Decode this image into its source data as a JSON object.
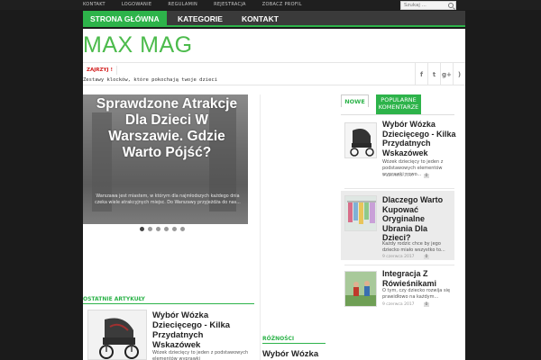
{
  "topbar": {
    "links": [
      "KONTAKT",
      "LOGOWANIE",
      "REGULAMIN",
      "REJESTRACJA",
      "ZOBACZ PROFIL"
    ],
    "search_placeholder": "Szukaj ..."
  },
  "nav": {
    "items": [
      "STRONA GŁÓWNA",
      "KATEGORIE",
      "KONTAKT"
    ],
    "active_index": 0,
    "accent_color": "#2db34a"
  },
  "logo": {
    "text": "MAX MAG"
  },
  "ticker": {
    "label": "ZAJRZYJ !",
    "text": "Zestawy klocków, które pokochają twoje dzieci"
  },
  "social_icons": [
    "facebook-icon",
    "twitter-icon",
    "googleplus-icon",
    "rss-icon"
  ],
  "slider": {
    "title": "Sprawdzone Atrakcje Dla Dzieci W Warszawie. Gdzie Warto Pójść?",
    "excerpt": "Warszawa jest miastem, w którym dla najmłodszych każdego dnia czeka wiele atrakcyjnych miejsc. Do Warszawy przyjeżdża do nas...",
    "dot_count": 6,
    "active_dot": 0
  },
  "recent": {
    "label": "OSTATNIE ARTYKUŁY",
    "title": "Wybór Wózka Dziecięcego - Kilka Przydatnych Wskazówek",
    "excerpt": "Wózek dziecięcy to jeden z podstawowych elementów wyprawki"
  },
  "misc": {
    "label": "RÓŻNOŚCI",
    "title": "Wybór Wózka Dziecięcego"
  },
  "sidebar": {
    "tab_new": "NOWE",
    "tab_popular": "POPULARNE",
    "tab_comments": "KOMENTARZE",
    "items": [
      {
        "title": "Wybór Wózka Dziecięcego - Kilka Przydatnych Wskazówek",
        "excerpt": "Wózek dziecięcy to jeden z podstawowych elementów wyprawki nowo...",
        "date": "9 czerwca 2017",
        "comments": "0"
      },
      {
        "title": "Dlaczego Warto Kupować Oryginalne Ubrania Dla Dzieci?",
        "excerpt": "Każdy rodzic chce by jego dziecko miało wszystko to...",
        "date": "9 czerwca 2017",
        "comments": "0"
      },
      {
        "title": "Integracja Z Rówieśnikami",
        "excerpt": "O tym, czy dziecko rozwija się prawidłowo na każdym...",
        "date": "9 czerwca 2017",
        "comments": "0"
      }
    ]
  }
}
